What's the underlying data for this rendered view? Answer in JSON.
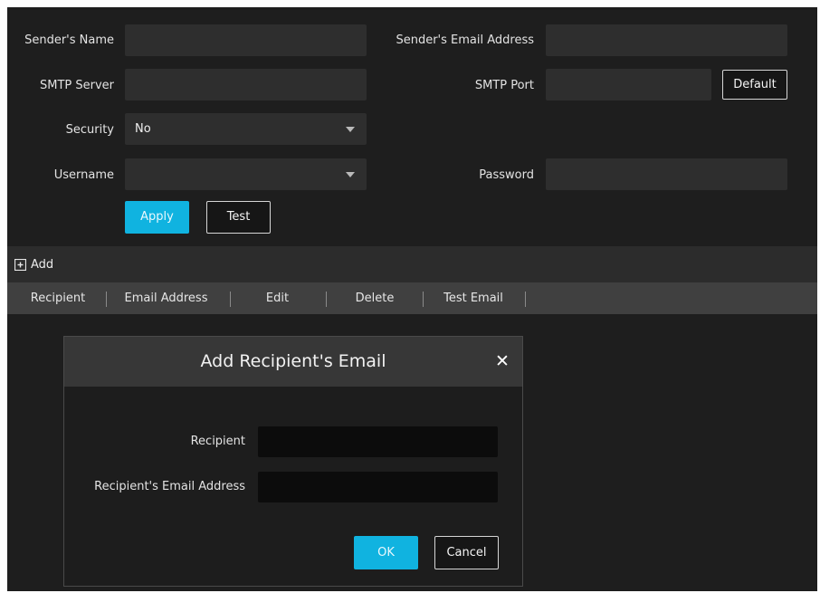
{
  "form": {
    "senders_name_label": "Sender's Name",
    "senders_email_label": "Sender's Email Address",
    "smtp_server_label": "SMTP Server",
    "smtp_port_label": "SMTP Port",
    "default_button": "Default",
    "security_label": "Security",
    "security_value": "No",
    "username_label": "Username",
    "password_label": "Password",
    "apply_button": "Apply",
    "test_button": "Test"
  },
  "add_bar": {
    "icon": "plus-square-icon",
    "label": "Add"
  },
  "table": {
    "columns": [
      "Recipient",
      "Email Address",
      "Edit",
      "Delete",
      "Test Email"
    ]
  },
  "dialog": {
    "title": "Add Recipient's Email",
    "close_glyph": "✕",
    "recipient_label": "Recipient",
    "recipient_email_label": "Recipient's Email Address",
    "ok_button": "OK",
    "cancel_button": "Cancel"
  },
  "colors": {
    "accent": "#10b3e0",
    "background": "#1e1e1e",
    "field": "#2e2e2e",
    "header": "#404040"
  }
}
